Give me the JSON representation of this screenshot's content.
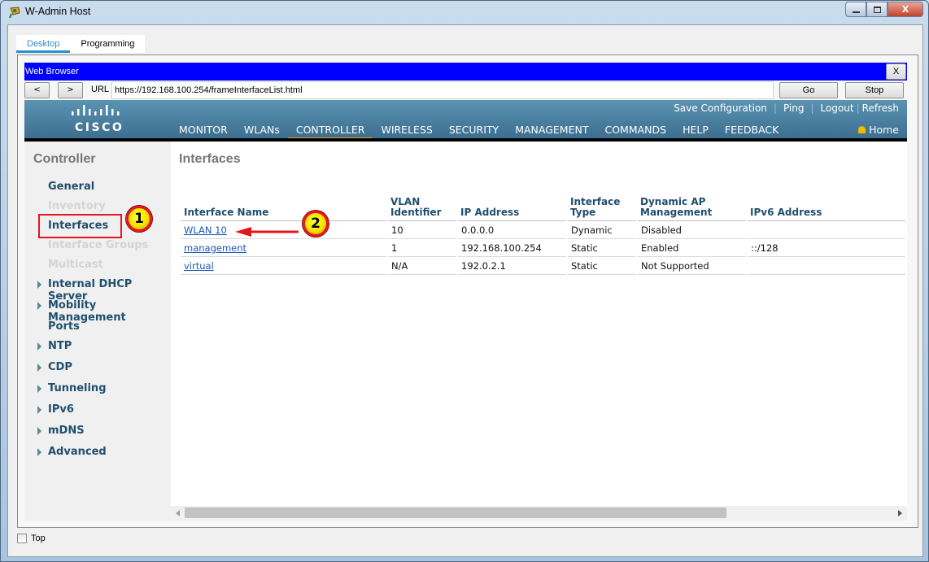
{
  "window": {
    "title": "W-Admin Host",
    "buttons": {
      "minimize": "—",
      "maximize": "□",
      "close": "X"
    }
  },
  "tabs": [
    {
      "label": "Desktop",
      "active": true
    },
    {
      "label": "Programming",
      "active": false
    }
  ],
  "browser": {
    "title": "Web Browser",
    "close_label": "X",
    "back_label": "<",
    "forward_label": ">",
    "url_label": "URL",
    "url": "https://192.168.100.254/frameInterfaceList.html",
    "go_label": "Go",
    "stop_label": "Stop"
  },
  "cisco": {
    "logo_text": "CISCO",
    "top_links": [
      "Save Configuration",
      "Ping",
      "Logout",
      "Refresh"
    ],
    "menu": [
      {
        "label": "MONITOR",
        "active": false
      },
      {
        "label": "WLANs",
        "active": false
      },
      {
        "label": "CONTROLLER",
        "active": true
      },
      {
        "label": "WIRELESS",
        "active": false
      },
      {
        "label": "SECURITY",
        "active": false
      },
      {
        "label": "MANAGEMENT",
        "active": false
      },
      {
        "label": "COMMANDS",
        "active": false
      },
      {
        "label": "HELP",
        "active": false
      },
      {
        "label": "FEEDBACK",
        "active": false
      }
    ],
    "home_label": "Home",
    "accent_color": "#f7941d"
  },
  "sidebar": {
    "title": "Controller",
    "items": [
      {
        "label": "General",
        "enabled": true,
        "expandable": false
      },
      {
        "label": "Inventory",
        "enabled": false,
        "expandable": false
      },
      {
        "label": "Interfaces",
        "enabled": true,
        "expandable": false
      },
      {
        "label": "Interface Groups",
        "enabled": false,
        "expandable": false
      },
      {
        "label": "Multicast",
        "enabled": false,
        "expandable": false
      },
      {
        "label": "Internal DHCP Server",
        "enabled": true,
        "expandable": true
      },
      {
        "label": "Mobility Management",
        "enabled": true,
        "expandable": true
      },
      {
        "label": "Ports",
        "enabled": true,
        "expandable": false
      },
      {
        "label": "NTP",
        "enabled": true,
        "expandable": true
      },
      {
        "label": "CDP",
        "enabled": true,
        "expandable": true
      },
      {
        "label": "Tunneling",
        "enabled": true,
        "expandable": true
      },
      {
        "label": "IPv6",
        "enabled": true,
        "expandable": true
      },
      {
        "label": "mDNS",
        "enabled": true,
        "expandable": true
      },
      {
        "label": "Advanced",
        "enabled": true,
        "expandable": true
      }
    ]
  },
  "content": {
    "title": "Interfaces",
    "table": {
      "headers": [
        "Interface Name",
        "VLAN Identifier",
        "IP Address",
        "Interface Type",
        "Dynamic AP Management",
        "IPv6 Address"
      ],
      "rows": [
        [
          "WLAN 10",
          "10",
          "0.0.0.0",
          "Dynamic",
          "Disabled",
          ""
        ],
        [
          "management",
          "1",
          "192.168.100.254",
          "Static",
          "Enabled",
          "::/128"
        ],
        [
          "virtual",
          "N/A",
          "192.0.2.1",
          "Static",
          "Not Supported",
          ""
        ]
      ]
    }
  },
  "annotations": {
    "badge1": "1",
    "badge2": "2"
  },
  "footer": {
    "top_checkbox_label": "Top",
    "top_checked": false
  }
}
